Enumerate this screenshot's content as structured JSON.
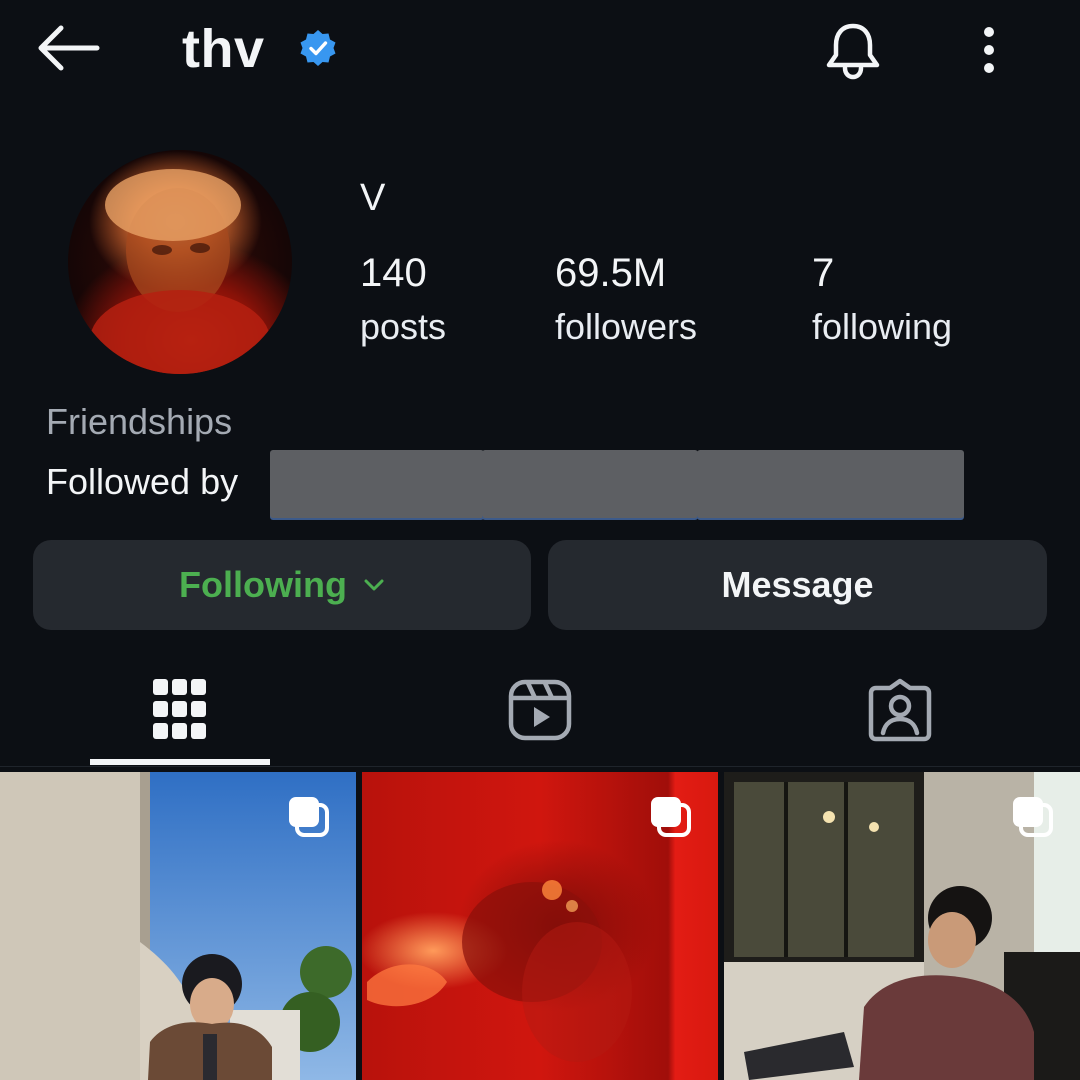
{
  "header": {
    "username": "thv",
    "back_icon": "arrow-left-icon",
    "verified_icon": "verified-badge-icon",
    "bell_icon": "bell-icon",
    "more_icon": "more-vertical-icon"
  },
  "profile": {
    "display_name": "V",
    "stats": {
      "posts": {
        "value": "140",
        "label": "posts"
      },
      "followers": {
        "value": "69.5M",
        "label": "followers"
      },
      "following": {
        "value": "7",
        "label": "following"
      }
    },
    "friendships_label": "Friendships",
    "followed_by_label": "Followed by"
  },
  "actions": {
    "following_label": "Following",
    "message_label": "Message"
  },
  "tabs": [
    {
      "icon": "grid-icon",
      "selected": true
    },
    {
      "icon": "reels-icon",
      "selected": false
    },
    {
      "icon": "tagged-icon",
      "selected": false
    }
  ],
  "colors": {
    "background": "#0c0f14",
    "button_bg": "#25292f",
    "following_green": "#4caf50",
    "verified_blue": "#3897f0",
    "muted_text": "#a4aab3"
  },
  "posts": [
    {
      "multi": true
    },
    {
      "multi": true
    },
    {
      "multi": true
    }
  ]
}
